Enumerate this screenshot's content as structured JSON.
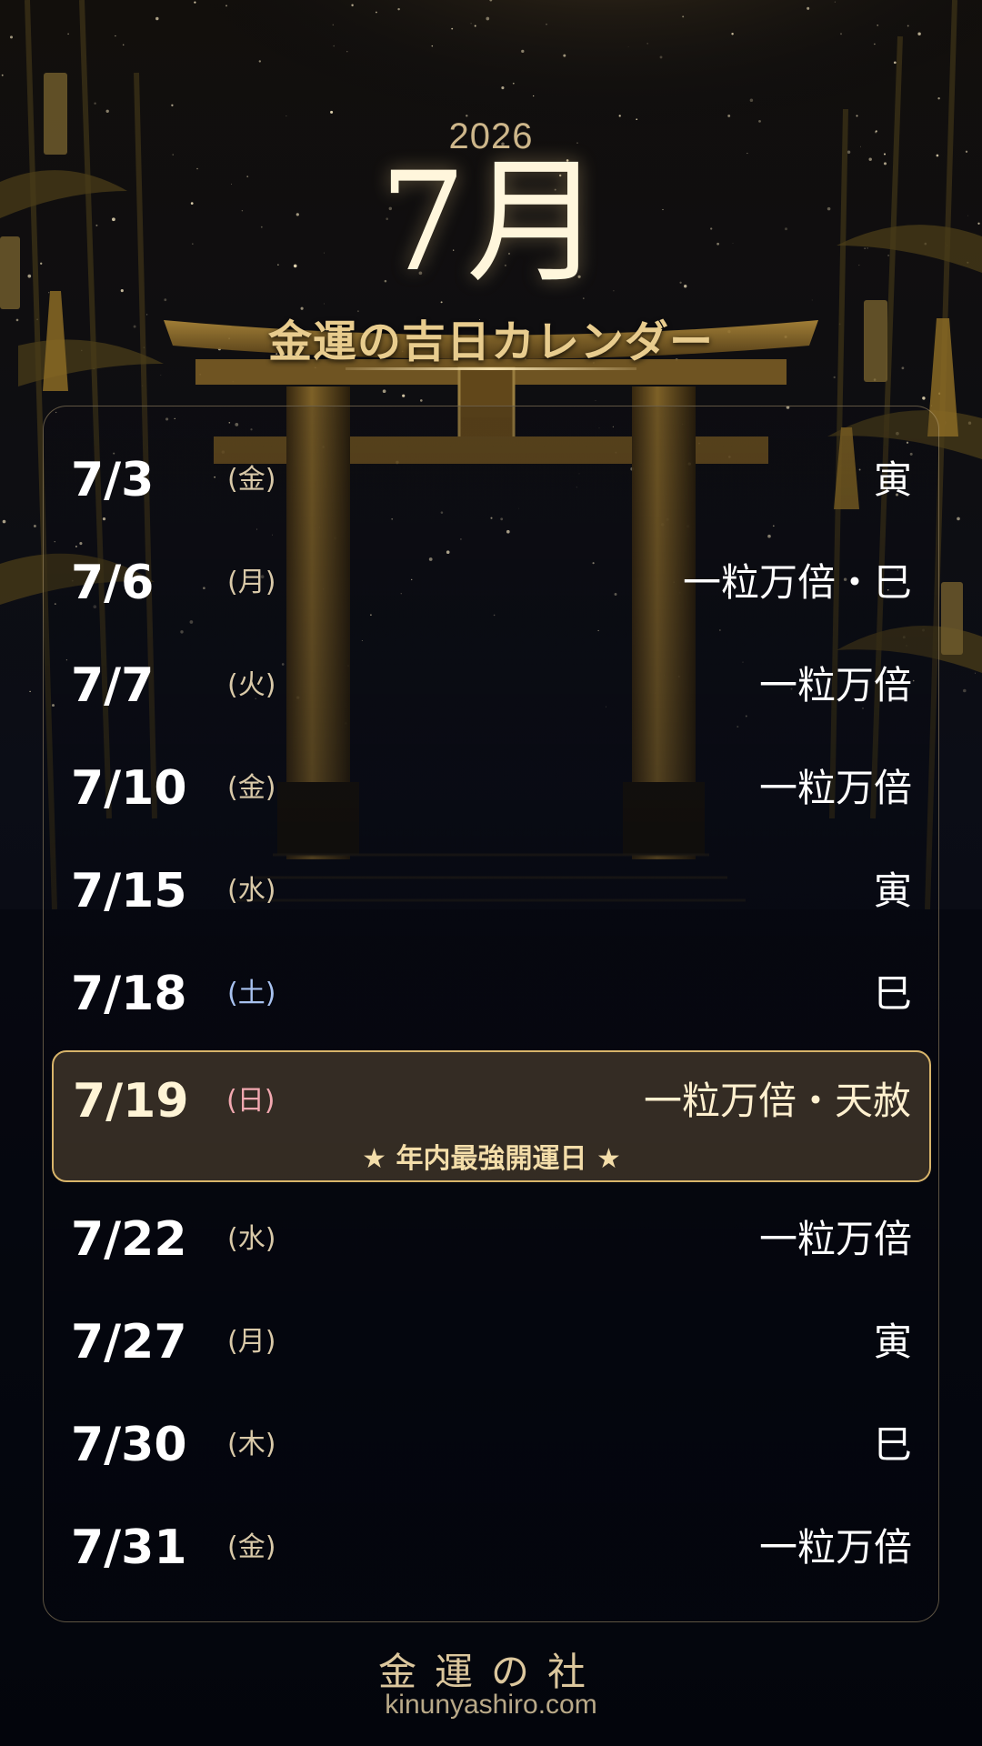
{
  "header": {
    "year": "2026",
    "month": "7月",
    "title": "金運の吉日カレンダー"
  },
  "days": [
    {
      "date": "7/3",
      "dow": "(金)",
      "tag": "寅"
    },
    {
      "date": "7/6",
      "dow": "(月)",
      "tag": "一粒万倍・巳"
    },
    {
      "date": "7/7",
      "dow": "(火)",
      "tag": "一粒万倍"
    },
    {
      "date": "7/10",
      "dow": "(金)",
      "tag": "一粒万倍"
    },
    {
      "date": "7/15",
      "dow": "(水)",
      "tag": "寅"
    },
    {
      "date": "7/18",
      "dow": "(土)",
      "tag": "巳"
    },
    {
      "date": "7/19",
      "dow": "(日)",
      "tag": "一粒万倍・天赦"
    },
    {
      "date": "7/22",
      "dow": "(水)",
      "tag": "一粒万倍"
    },
    {
      "date": "7/27",
      "dow": "(月)",
      "tag": "寅"
    },
    {
      "date": "7/30",
      "dow": "(木)",
      "tag": "巳"
    },
    {
      "date": "7/31",
      "dow": "(金)",
      "tag": "一粒万倍"
    }
  ],
  "highlight": {
    "note": "★ 年内最強開運日 ★"
  },
  "footer": {
    "name": "金運の社",
    "url": "kinunyashiro.com"
  },
  "colors": {
    "gold": "#d8b46a",
    "saturday": "#a8c2f0",
    "sunday": "#f2a8b0"
  }
}
